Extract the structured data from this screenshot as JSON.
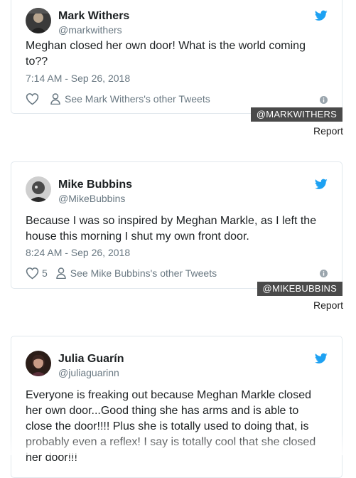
{
  "tweets": [
    {
      "name": "Mark Withers",
      "handle": "@markwithers",
      "text": "Meghan closed her own door! What is the world coming to??",
      "timestamp": "7:14 AM - Sep 26, 2018",
      "likes": "",
      "other_tweets_label": "See Mark Withers's other Tweets",
      "credit": "@MARKWITHERS",
      "report": "Report"
    },
    {
      "name": "Mike Bubbins",
      "handle": "@MikeBubbins",
      "text": "Because I was so inspired by Meghan Markle, as I left the house this morning I shut my own front door.",
      "timestamp": "8:24 AM - Sep 26, 2018",
      "likes": "5",
      "other_tweets_label": "See Mike Bubbins's other Tweets",
      "credit": "@MIKEBUBBINS",
      "report": "Report"
    },
    {
      "name": "Julia Guarín",
      "handle": "@juliaguarinn",
      "text": "Everyone is freaking out because Meghan Markle closed her own door...Good thing she has arms and is able to close the door!!!! Plus she is totally used to doing that, is probably even a reflex! I say is totally cool that she closed her door!!!"
    }
  ],
  "colors": {
    "twitter_blue": "#1da1f2",
    "muted_text": "#697882",
    "credit_bg": "#4a4a4a"
  },
  "icons": [
    "twitter-bird-icon",
    "heart-icon",
    "person-icon",
    "info-icon"
  ]
}
